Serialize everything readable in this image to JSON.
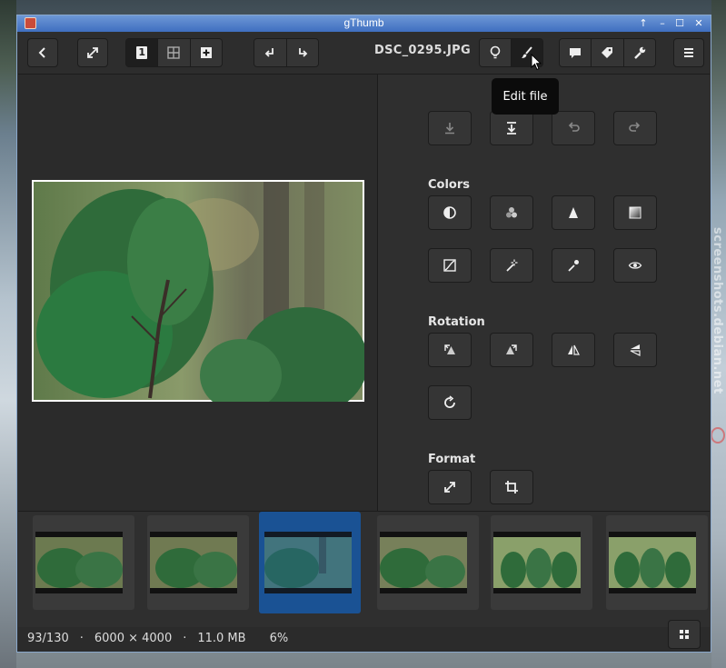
{
  "window": {
    "title": "gThumb"
  },
  "header": {
    "filename": "DSC_0295.JPG",
    "tooltip": "Edit file",
    "view_group": [
      "1",
      "grid",
      "plus"
    ]
  },
  "tools": {
    "sections": {
      "colors": "Colors",
      "rotation": "Rotation",
      "format": "Format"
    },
    "icons": {
      "row0": [
        "save-icon",
        "save-as-icon",
        "undo-icon",
        "redo-icon"
      ],
      "colors1": [
        "adjust-contrast-icon",
        "adjust-colors-icon",
        "sharpen-icon",
        "grayscale-icon"
      ],
      "colors2": [
        "curves-icon",
        "magic-wand-icon",
        "color-picker-icon",
        "red-eye-icon"
      ],
      "rotation1": [
        "rotate-left-icon",
        "rotate-right-icon",
        "flip-icon",
        "mirror-icon"
      ],
      "rotation2": [
        "rotate-icon"
      ],
      "format": [
        "resize-icon",
        "crop-icon"
      ]
    }
  },
  "status": {
    "position": "93/130",
    "sep1": "·",
    "dimensions": "6000 × 4000",
    "sep2": "·",
    "size": "11.0 MB",
    "zoom": "6%"
  },
  "watermark": "screenshots.debian.net",
  "colors": {
    "accent": "#1a5294",
    "titlebar": "#3f6fc0",
    "window_bg": "#2e2e2e"
  }
}
